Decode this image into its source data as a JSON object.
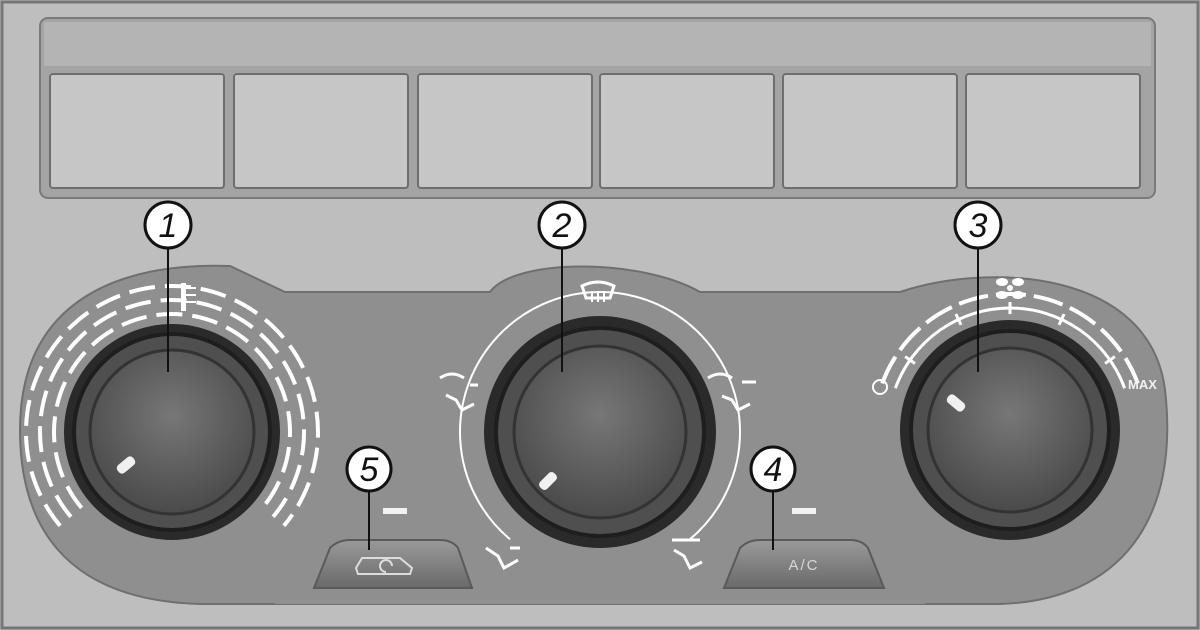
{
  "callouts": {
    "temperature_knob": "1",
    "air_distribution_knob": "2",
    "fan_speed_knob": "3",
    "ac_button": "4",
    "recirculation_button": "5"
  },
  "fan_scale": {
    "min_label": "O",
    "max_label": "MAX"
  },
  "buttons": {
    "ac_label": "A/C"
  },
  "icons": {
    "temperature": "temperature-icon",
    "defrost": "windshield-defrost-icon",
    "fan": "fan-icon",
    "vent_face": "vent-face-icon",
    "vent_face_feet": "vent-face-feet-icon",
    "vent_feet": "vent-feet-icon",
    "vent_feet_defrost": "vent-feet-defrost-icon",
    "recirculation": "air-recirculation-icon"
  },
  "colors": {
    "panel": "#8e8e8e",
    "frame": "#bdbdbd",
    "knob": "#5a5a5a",
    "markings": "#ffffff"
  }
}
